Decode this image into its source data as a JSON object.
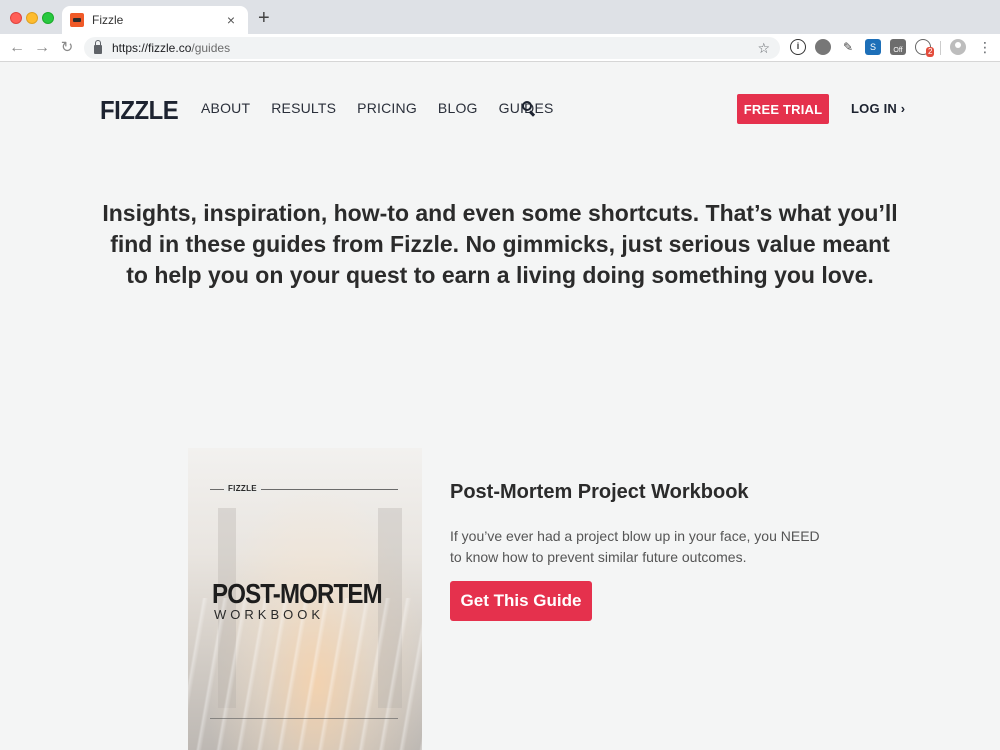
{
  "browser": {
    "tab_title": "Fizzle",
    "tab_close": "×",
    "new_tab": "+",
    "url_host": "https://fizzle.co",
    "url_path": "/guides",
    "back": "←",
    "forward": "→",
    "reload": "↻",
    "star": "☆",
    "extension_badge": "2",
    "extension_off_label": "Off",
    "menu": "⋮"
  },
  "header": {
    "logo": "FIZZLE",
    "nav": [
      {
        "label": "ABOUT"
      },
      {
        "label": "RESULTS"
      },
      {
        "label": "PRICING"
      },
      {
        "label": "BLOG"
      },
      {
        "label": "GUIDES"
      }
    ],
    "free_trial_label": "FREE TRIAL",
    "login_label": "LOG IN ›"
  },
  "hero": {
    "text": "Insights, inspiration, how-to and even some shortcuts. That’s what you’ll find in these guides from Fizzle. No gimmicks, just serious value meant to help you on your quest to earn a living doing something you love."
  },
  "guide": {
    "cover_brand": "FIZZLE",
    "cover_title": "POST-MORTEM",
    "cover_subtitle": "WORKBOOK",
    "title": "Post-Mortem Project Workbook",
    "description": "If you’ve ever had a project blow up in your face, you NEED to know how to prevent similar future outcomes.",
    "button_label": "Get This Guide"
  },
  "colors": {
    "accent": "#e5314d",
    "logo": "#1d2330",
    "background": "#f4f5f5"
  }
}
